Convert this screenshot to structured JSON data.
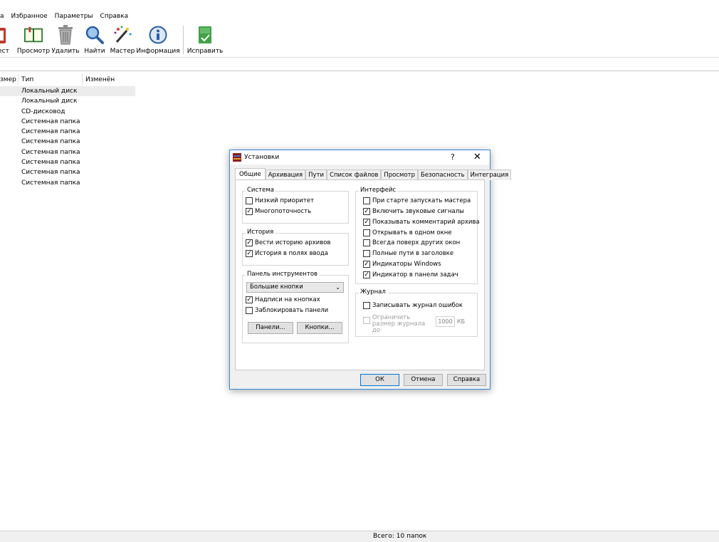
{
  "menu": [
    "а",
    "Избранное",
    "Параметры",
    "Справка"
  ],
  "toolbar": {
    "buttons": [
      "ест",
      "Просмотр",
      "Удалить",
      "Найти",
      "Мастер",
      "Информация",
      "Исправить"
    ]
  },
  "list": {
    "columns": [
      "змер",
      "Тип",
      "Изменён"
    ],
    "rows": [
      "Локальный диск",
      "Локальный диск",
      "CD-дисковод",
      "Системная папка",
      "Системная папка",
      "Системная папка",
      "Системная папка",
      "Системная папка",
      "Системная папка",
      "Системная папка"
    ]
  },
  "status": {
    "text": "Всего: 10 папок"
  },
  "dialog": {
    "title": "Установки",
    "help_glyph": "?",
    "close_glyph": "✕",
    "tabs": [
      "Общие",
      "Архивация",
      "Пути",
      "Список файлов",
      "Просмотр",
      "Безопасность",
      "Интеграция"
    ],
    "system": {
      "title": "Система",
      "items": [
        {
          "label": "Низкий приоритет",
          "checked": false
        },
        {
          "label": "Многопоточность",
          "checked": true
        }
      ]
    },
    "history": {
      "title": "История",
      "items": [
        {
          "label": "Вести историю архивов",
          "checked": true
        },
        {
          "label": "История в полях ввода",
          "checked": true
        }
      ]
    },
    "toolbar_panel": {
      "title": "Панель инструментов",
      "combo_value": "Большие кнопки",
      "items": [
        {
          "label": "Надписи на кнопках",
          "checked": true
        },
        {
          "label": "Заблокировать панели",
          "checked": false
        }
      ],
      "panels_button": "Панели...",
      "buttons_button": "Кнопки..."
    },
    "interface": {
      "title": "Интерфейс",
      "items": [
        {
          "label": "При старте запускать мастера",
          "checked": false
        },
        {
          "label": "Включить звуковые сигналы",
          "checked": true
        },
        {
          "label": "Показывать комментарий архива",
          "checked": true
        },
        {
          "label": "Открывать в одном окне",
          "checked": false
        },
        {
          "label": "Всегда поверх других окон",
          "checked": false
        },
        {
          "label": "Полные пути в заголовке",
          "checked": false
        },
        {
          "label": "Индикаторы Windows",
          "checked": true
        },
        {
          "label": "Индикатор в панели задач",
          "checked": true
        }
      ]
    },
    "journal": {
      "title": "Журнал",
      "log_errors": {
        "label": "Записывать журнал ошибок",
        "checked": false
      },
      "limit": {
        "label": "Ограничить размер журнала до",
        "checked": false
      },
      "limit_value": "1000",
      "limit_unit": "КБ"
    },
    "ok": "ОК",
    "cancel": "Отмена",
    "help": "Справка"
  }
}
